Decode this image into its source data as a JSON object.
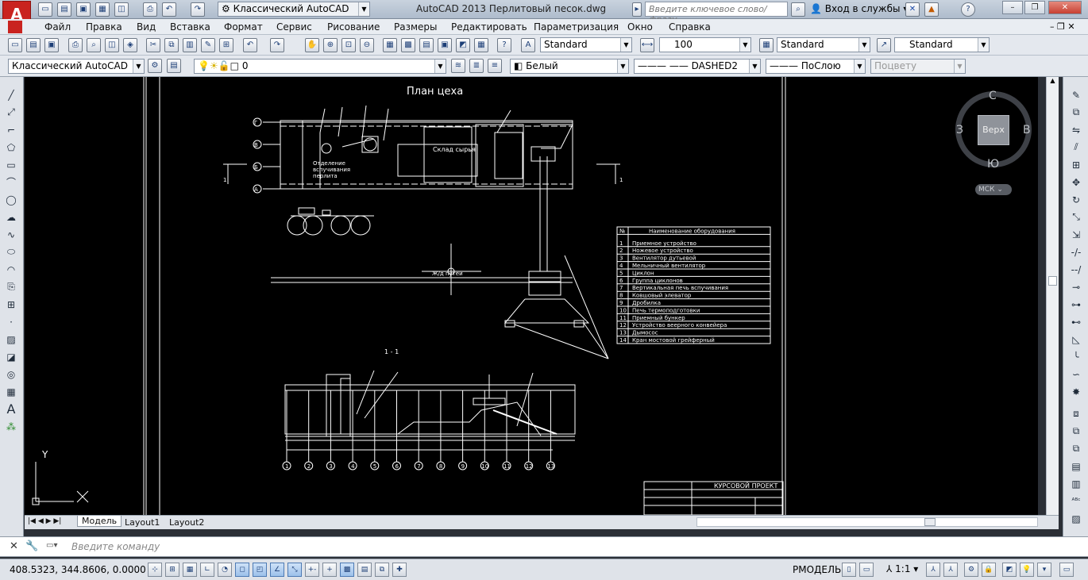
{
  "app": {
    "logo_letter": "A",
    "workspace": "Классический AutoCAD",
    "title": "AutoCAD 2013   Перлитовый песок.dwg",
    "search_placeholder": "Введите ключевое слово/фразу",
    "login_label": "Вход в службы"
  },
  "menu": [
    "Файл",
    "Правка",
    "Вид",
    "Вставка",
    "Формат",
    "Сервис",
    "Рисование",
    "Размеры",
    "Редактировать",
    "Параметризация",
    "Окно",
    "Справка"
  ],
  "toolbar2": {
    "text_style": "Standard",
    "dim_scale": "100",
    "dim_style": "Standard",
    "table_style": "Standard"
  },
  "toolbar3": {
    "workspace": "Классический AutoCAD",
    "layer": "0",
    "color": "Белый",
    "linetype": "DASHED2",
    "lineweight": "ПоСлою",
    "plotstyle": "Поцвету"
  },
  "viewcube": {
    "n": "С",
    "s": "Ю",
    "w": "З",
    "e": "В",
    "top": "Верх",
    "ucs": "МСК"
  },
  "drawing": {
    "title": "План цеха",
    "section_title": "1 - 1",
    "storage_label": "Склад сырья",
    "rail_label": "Ж/д путей",
    "dept_label": [
      "Отделение",
      "вспучивания",
      "перлита"
    ],
    "section_mark": "1",
    "grid_rows": [
      "Г",
      "В",
      "Б",
      "А"
    ],
    "grid_cols": [
      "1",
      "2",
      "3",
      "4",
      "5",
      "6",
      "7",
      "8",
      "9",
      "10",
      "11",
      "12",
      "13"
    ],
    "titleblock": "КУРСОВОЙ ПРОЕКТ",
    "table_header": [
      "№",
      "Наименование оборудования"
    ],
    "equipment": [
      [
        "1",
        "Приемное устройство"
      ],
      [
        "2",
        "Ножевое устройство"
      ],
      [
        "3",
        "Вентилятор дутьевой"
      ],
      [
        "4",
        "Мельничный вентилятор"
      ],
      [
        "5",
        "Циклон"
      ],
      [
        "6",
        "Группа циклонов"
      ],
      [
        "7",
        "Вертикальная печь вспучивания"
      ],
      [
        "8",
        "Ковшовый элеватор"
      ],
      [
        "9",
        "Дробилка"
      ],
      [
        "10",
        "Печь термоподготовки"
      ],
      [
        "11",
        "Приемный бункер"
      ],
      [
        "12",
        "Устройство веерного конвейера"
      ],
      [
        "13",
        "Дымосос"
      ],
      [
        "14",
        "Кран мостовой грейферный"
      ]
    ]
  },
  "layout_tabs": [
    "Модель",
    "Layout1",
    "Layout2"
  ],
  "command_placeholder": "Введите команду",
  "status": {
    "coords": "408.5323, 344.8606, 0.0000",
    "space": "РМОДЕЛЬ",
    "annoscale": "1:1"
  }
}
